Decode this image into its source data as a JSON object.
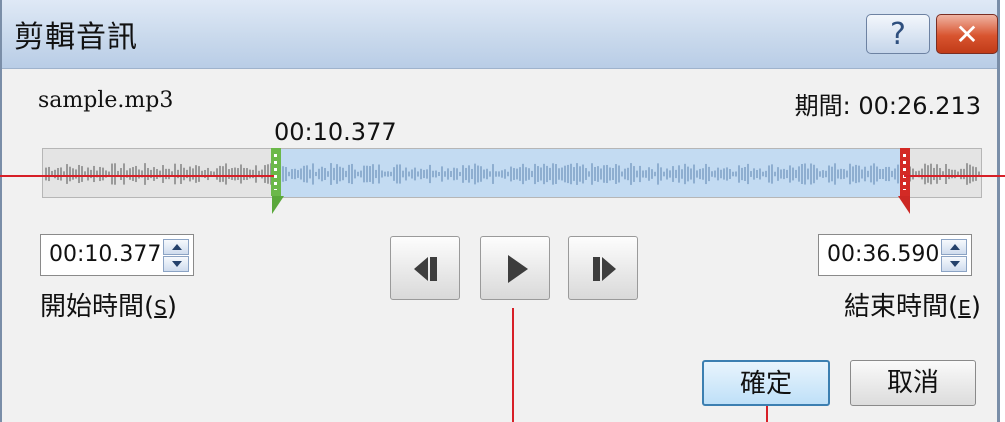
{
  "dialog": {
    "title": "剪輯音訊",
    "help_label": "?",
    "close_label": "✕"
  },
  "file": {
    "name": "sample.mp3",
    "duration_label": "期間:",
    "duration_value": "00:26.213"
  },
  "timeline": {
    "start_marker_time": "00:10.377",
    "start_marker_color": "#6bb84a",
    "end_marker_color": "#d32a25",
    "selection_color": "#c3dbf2"
  },
  "start_time": {
    "value": "00:10.377",
    "label": "開始時間(",
    "accel": "S",
    "label_end": ")"
  },
  "end_time": {
    "value": "00:36.590",
    "label": "結束時間(",
    "accel": "E",
    "label_end": ")"
  },
  "transport": {
    "previous_icon": "previous-frame-icon",
    "play_icon": "play-icon",
    "next_icon": "next-frame-icon"
  },
  "buttons": {
    "ok": "確定",
    "cancel": "取消"
  },
  "callout_color": "#d71f27"
}
